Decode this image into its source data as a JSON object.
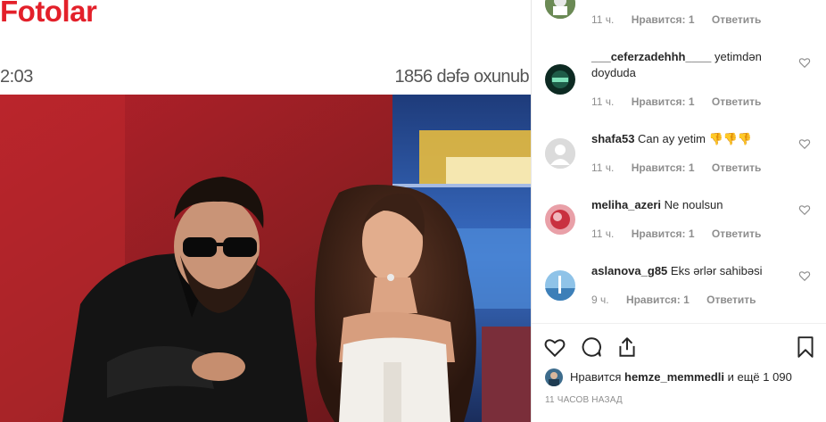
{
  "article": {
    "section_title": "Fotolar",
    "time": "2:03",
    "views": "1856 dəfə oxunub"
  },
  "comments": [
    {
      "user": "",
      "text": "",
      "time": "11 ч.",
      "likes": "Нравится: 1",
      "reply": "Ответить",
      "has_heart": false
    },
    {
      "user": "___ceferzadehhh____",
      "text": "yetimdən doydudа",
      "time": "11 ч.",
      "likes": "Нравится: 1",
      "reply": "Ответить",
      "has_heart": true
    },
    {
      "user": "shafa53",
      "text": "Can ay yetim 👎👎👎",
      "time": "11 ч.",
      "likes": "Нравится: 1",
      "reply": "Ответить",
      "has_heart": true
    },
    {
      "user": "meliha_azeri",
      "text": "Ne noulsun",
      "time": "11 ч.",
      "likes": "Нравится: 1",
      "reply": "Ответить",
      "has_heart": true
    },
    {
      "user": "aslanova_g85",
      "text": "Eks ərlər sahibəsi",
      "time": "9 ч.",
      "likes": "Нравится: 1",
      "reply": "Ответить",
      "has_heart": true
    }
  ],
  "likes": {
    "prefix": "Нравится",
    "user": "hemze_memmedli",
    "suffix": "и ещё 1 090"
  },
  "timestamp": "11 ЧАСОВ НАЗАД",
  "icons": [
    "heart-icon",
    "comment-icon",
    "share-icon",
    "bookmark-icon"
  ],
  "colors": {
    "brand_red": "#e3202a",
    "meta_gray": "#8e8e8e",
    "text": "#262626"
  }
}
